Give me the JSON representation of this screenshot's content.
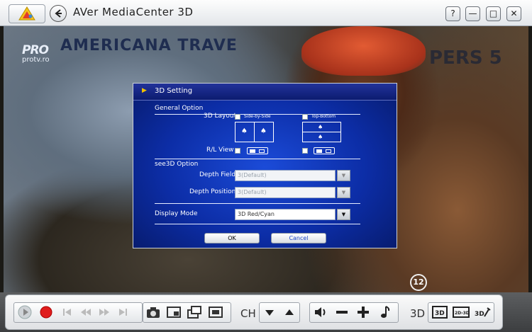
{
  "window": {
    "title": "AVer MediaCenter 3D",
    "buttons": {
      "help": "?",
      "minimize": "—",
      "maximize": "□",
      "close": "✕"
    }
  },
  "video": {
    "channel_logo_text": "PRO",
    "channel_logo_sub": "protv.ro",
    "sign_left": "AMERICANA TRAVE",
    "sign_right": "PERS 5",
    "channel_number": "12"
  },
  "dialog": {
    "title": "3D Setting",
    "general": {
      "section_label": "General Option",
      "layout_label": "3D Layout",
      "option_side_by_side": "Side-by-Side",
      "option_top_bottom": "Top-Bottom",
      "rl_view_label": "R/L View"
    },
    "see3d": {
      "section_label": "see3D Option",
      "depth_field_label": "Depth Field",
      "depth_field_value": "3(Default)",
      "depth_position_label": "Depth Position",
      "depth_position_value": "3(Default)"
    },
    "display": {
      "label": "Display Mode",
      "value": "3D Red/Cyan"
    },
    "ok_label": "OK",
    "cancel_label": "Cancel"
  },
  "controls": {
    "ch_label": "CH",
    "mode_label": "3D",
    "icons": [
      "play-icon",
      "record-icon",
      "skip-back-icon",
      "rewind-icon",
      "fast-forward-icon",
      "skip-forward-icon",
      "snapshot-icon",
      "pip-icon",
      "multi-channel-icon",
      "timeshift-icon",
      "channel-down-icon",
      "channel-up-icon",
      "mute-icon",
      "volume-down-icon",
      "volume-up-icon",
      "audio-icon",
      "3d-view-icon",
      "2d-to-3d-icon",
      "3d-settings-icon"
    ]
  }
}
